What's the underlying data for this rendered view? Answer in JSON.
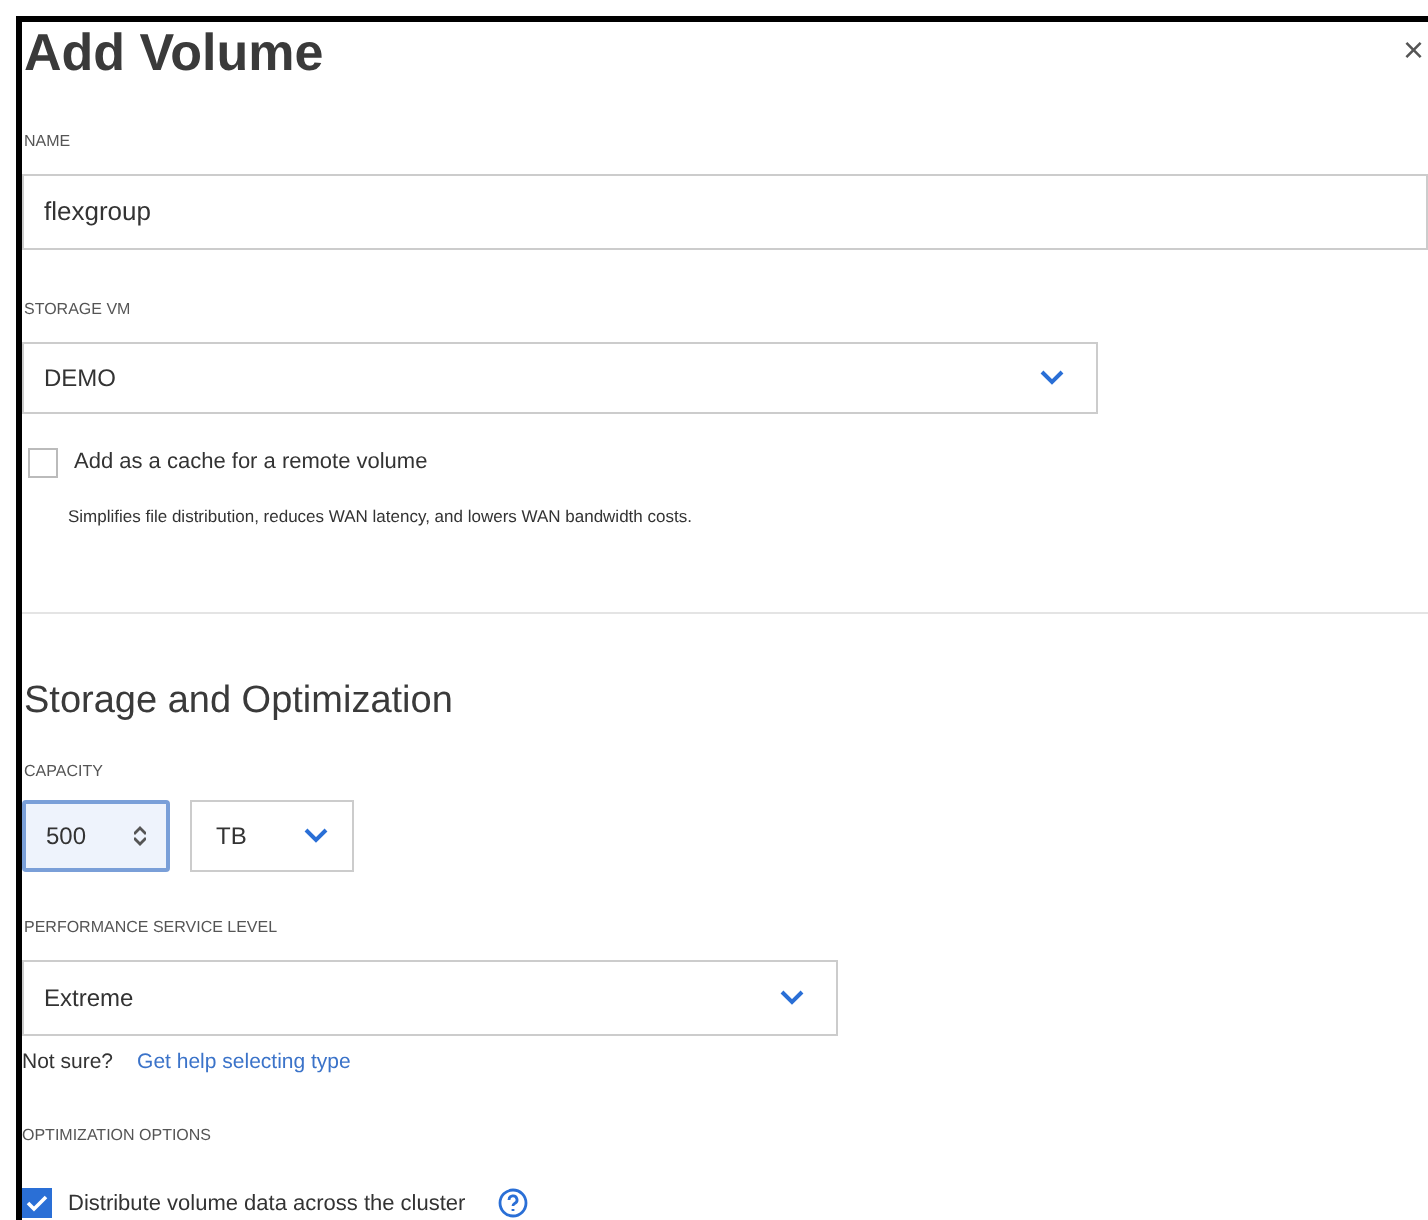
{
  "title": "Add Volume",
  "close": "×",
  "name_field": {
    "label": "NAME",
    "value": "flexgroup"
  },
  "storage_vm": {
    "label": "STORAGE VM",
    "value": "DEMO"
  },
  "cache_option": {
    "label": "Add as a cache for a remote volume",
    "checked": false,
    "description": "Simplifies file distribution, reduces WAN latency, and lowers WAN bandwidth costs."
  },
  "section_title": "Storage and Optimization",
  "capacity": {
    "label": "CAPACITY",
    "value": "500",
    "unit": "TB"
  },
  "performance": {
    "label": "PERFORMANCE SERVICE LEVEL",
    "value": "Extreme",
    "hint": "Not sure?",
    "link": "Get help selecting type"
  },
  "optimization": {
    "label": "OPTIMIZATION OPTIONS",
    "options": [
      {
        "label": "Distribute volume data across the cluster",
        "checked": true
      }
    ]
  }
}
